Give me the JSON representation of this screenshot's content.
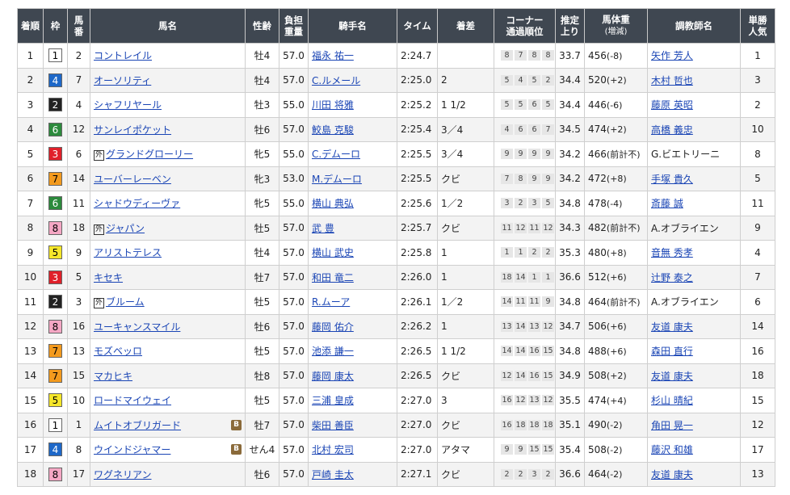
{
  "headers": {
    "rank": "着順",
    "waku": "枠",
    "num": [
      "馬",
      "番"
    ],
    "horse": "馬名",
    "sexage": "性齢",
    "weight": [
      "負担",
      "重量"
    ],
    "jockey": "騎手名",
    "time": "タイム",
    "margin": "着差",
    "corner": [
      "コーナー",
      "通過順位"
    ],
    "last3f": [
      "推定",
      "上り"
    ],
    "bodyweight": [
      "馬体重",
      "(増減)"
    ],
    "trainer": "調教師名",
    "pop": [
      "単勝",
      "人気"
    ]
  },
  "waku_colors": {
    "1": {
      "bg": "#ffffff",
      "fg": "#000000"
    },
    "2": {
      "bg": "#222222",
      "fg": "#ffffff"
    },
    "3": {
      "bg": "#e0202a",
      "fg": "#ffffff"
    },
    "4": {
      "bg": "#1e68c8",
      "fg": "#ffffff"
    },
    "5": {
      "bg": "#f5e62a",
      "fg": "#000000"
    },
    "6": {
      "bg": "#2c8a3c",
      "fg": "#ffffff"
    },
    "7": {
      "bg": "#f39a1e",
      "fg": "#000000"
    },
    "8": {
      "bg": "#f5a7c4",
      "fg": "#000000"
    }
  },
  "rows": [
    {
      "rank": "1",
      "waku": "1",
      "num": "2",
      "horse": "コントレイル",
      "foreign": false,
      "blinker": false,
      "sexage": "牡4",
      "weight": "57.0",
      "jockey": "福永 祐一",
      "time": "2:24.7",
      "margin": "",
      "corner": [
        "8",
        "7",
        "8",
        "8"
      ],
      "last3f": "33.7",
      "bw": "456",
      "bwd": "(-8)",
      "trainer": "矢作 芳人",
      "trainer_link": true,
      "pop": "1"
    },
    {
      "rank": "2",
      "waku": "4",
      "num": "7",
      "horse": "オーソリティ",
      "foreign": false,
      "blinker": false,
      "sexage": "牡4",
      "weight": "57.0",
      "jockey": "C.ルメール",
      "time": "2:25.0",
      "margin": "2",
      "corner": [
        "5",
        "4",
        "5",
        "2"
      ],
      "last3f": "34.4",
      "bw": "520",
      "bwd": "(+2)",
      "trainer": "木村 哲也",
      "trainer_link": true,
      "pop": "3"
    },
    {
      "rank": "3",
      "waku": "2",
      "num": "4",
      "horse": "シャフリヤール",
      "foreign": false,
      "blinker": false,
      "sexage": "牡3",
      "weight": "55.0",
      "jockey": "川田 将雅",
      "time": "2:25.2",
      "margin": "1 1/2",
      "corner": [
        "5",
        "5",
        "6",
        "5"
      ],
      "last3f": "34.4",
      "bw": "446",
      "bwd": "(-6)",
      "trainer": "藤原 英昭",
      "trainer_link": true,
      "pop": "2"
    },
    {
      "rank": "4",
      "waku": "6",
      "num": "12",
      "horse": "サンレイポケット",
      "foreign": false,
      "blinker": false,
      "sexage": "牡6",
      "weight": "57.0",
      "jockey": "鮫島 克駿",
      "time": "2:25.4",
      "margin": "3／4",
      "corner": [
        "4",
        "6",
        "6",
        "7"
      ],
      "last3f": "34.5",
      "bw": "474",
      "bwd": "(+2)",
      "trainer": "高橋 義忠",
      "trainer_link": true,
      "pop": "10"
    },
    {
      "rank": "5",
      "waku": "3",
      "num": "6",
      "horse": "グランドグローリー",
      "foreign": true,
      "blinker": false,
      "sexage": "牝5",
      "weight": "55.0",
      "jockey": "C.デムーロ",
      "time": "2:25.5",
      "margin": "3／4",
      "corner": [
        "9",
        "9",
        "9",
        "9"
      ],
      "last3f": "34.2",
      "bw": "466",
      "bwd": "(前計不)",
      "trainer": "G.ビエトリーニ",
      "trainer_link": false,
      "pop": "8"
    },
    {
      "rank": "6",
      "waku": "7",
      "num": "14",
      "horse": "ユーバーレーベン",
      "foreign": false,
      "blinker": false,
      "sexage": "牝3",
      "weight": "53.0",
      "jockey": "M.デムーロ",
      "time": "2:25.5",
      "margin": "クビ",
      "corner": [
        "7",
        "8",
        "9",
        "9"
      ],
      "last3f": "34.2",
      "bw": "472",
      "bwd": "(+8)",
      "trainer": "手塚 貴久",
      "trainer_link": true,
      "pop": "5"
    },
    {
      "rank": "7",
      "waku": "6",
      "num": "11",
      "horse": "シャドウディーヴァ",
      "foreign": false,
      "blinker": false,
      "sexage": "牝5",
      "weight": "55.0",
      "jockey": "横山 典弘",
      "time": "2:25.6",
      "margin": "1／2",
      "corner": [
        "3",
        "2",
        "3",
        "5"
      ],
      "last3f": "34.8",
      "bw": "478",
      "bwd": "(-4)",
      "trainer": "斎藤 誠",
      "trainer_link": true,
      "pop": "11"
    },
    {
      "rank": "8",
      "waku": "8",
      "num": "18",
      "horse": "ジャパン",
      "foreign": true,
      "blinker": false,
      "sexage": "牡5",
      "weight": "57.0",
      "jockey": "武 豊",
      "time": "2:25.7",
      "margin": "クビ",
      "corner": [
        "11",
        "12",
        "11",
        "12"
      ],
      "last3f": "34.3",
      "bw": "482",
      "bwd": "(前計不)",
      "trainer": "A.オブライエン",
      "trainer_link": false,
      "pop": "9"
    },
    {
      "rank": "9",
      "waku": "5",
      "num": "9",
      "horse": "アリストテレス",
      "foreign": false,
      "blinker": false,
      "sexage": "牡4",
      "weight": "57.0",
      "jockey": "横山 武史",
      "time": "2:25.8",
      "margin": "1",
      "corner": [
        "1",
        "1",
        "2",
        "2"
      ],
      "last3f": "35.3",
      "bw": "480",
      "bwd": "(+8)",
      "trainer": "音無 秀孝",
      "trainer_link": true,
      "pop": "4"
    },
    {
      "rank": "10",
      "waku": "3",
      "num": "5",
      "horse": "キセキ",
      "foreign": false,
      "blinker": false,
      "sexage": "牡7",
      "weight": "57.0",
      "jockey": "和田 竜二",
      "time": "2:26.0",
      "margin": "1",
      "corner": [
        "18",
        "14",
        "1",
        "1"
      ],
      "last3f": "36.6",
      "bw": "512",
      "bwd": "(+6)",
      "trainer": "辻野 泰之",
      "trainer_link": true,
      "pop": "7"
    },
    {
      "rank": "11",
      "waku": "2",
      "num": "3",
      "horse": "ブルーム",
      "foreign": true,
      "blinker": false,
      "sexage": "牡5",
      "weight": "57.0",
      "jockey": "R.ムーア",
      "time": "2:26.1",
      "margin": "1／2",
      "corner": [
        "14",
        "11",
        "11",
        "9"
      ],
      "last3f": "34.8",
      "bw": "464",
      "bwd": "(前計不)",
      "trainer": "A.オブライエン",
      "trainer_link": false,
      "pop": "6"
    },
    {
      "rank": "12",
      "waku": "8",
      "num": "16",
      "horse": "ユーキャンスマイル",
      "foreign": false,
      "blinker": false,
      "sexage": "牡6",
      "weight": "57.0",
      "jockey": "藤岡 佑介",
      "time": "2:26.2",
      "margin": "1",
      "corner": [
        "13",
        "14",
        "13",
        "12"
      ],
      "last3f": "34.7",
      "bw": "506",
      "bwd": "(+6)",
      "trainer": "友道 康夫",
      "trainer_link": true,
      "pop": "14"
    },
    {
      "rank": "13",
      "waku": "7",
      "num": "13",
      "horse": "モズベッロ",
      "foreign": false,
      "blinker": false,
      "sexage": "牡5",
      "weight": "57.0",
      "jockey": "池添 謙一",
      "time": "2:26.5",
      "margin": "1 1/2",
      "corner": [
        "14",
        "14",
        "16",
        "15"
      ],
      "last3f": "34.8",
      "bw": "488",
      "bwd": "(+6)",
      "trainer": "森田 直行",
      "trainer_link": true,
      "pop": "16"
    },
    {
      "rank": "14",
      "waku": "7",
      "num": "15",
      "horse": "マカヒキ",
      "foreign": false,
      "blinker": false,
      "sexage": "牡8",
      "weight": "57.0",
      "jockey": "藤岡 康太",
      "time": "2:26.5",
      "margin": "クビ",
      "corner": [
        "12",
        "14",
        "16",
        "15"
      ],
      "last3f": "34.9",
      "bw": "508",
      "bwd": "(+2)",
      "trainer": "友道 康夫",
      "trainer_link": true,
      "pop": "18"
    },
    {
      "rank": "15",
      "waku": "5",
      "num": "10",
      "horse": "ロードマイウェイ",
      "foreign": false,
      "blinker": false,
      "sexage": "牡5",
      "weight": "57.0",
      "jockey": "三浦 皇成",
      "time": "2:27.0",
      "margin": "3",
      "corner": [
        "16",
        "12",
        "13",
        "12"
      ],
      "last3f": "35.5",
      "bw": "474",
      "bwd": "(+4)",
      "trainer": "杉山 晴紀",
      "trainer_link": true,
      "pop": "15"
    },
    {
      "rank": "16",
      "waku": "1",
      "num": "1",
      "horse": "ムイトオブリガード",
      "foreign": false,
      "blinker": true,
      "sexage": "牡7",
      "weight": "57.0",
      "jockey": "柴田 善臣",
      "time": "2:27.0",
      "margin": "クビ",
      "corner": [
        "16",
        "18",
        "18",
        "18"
      ],
      "last3f": "35.1",
      "bw": "490",
      "bwd": "(-2)",
      "trainer": "角田 晃一",
      "trainer_link": true,
      "pop": "12"
    },
    {
      "rank": "17",
      "waku": "4",
      "num": "8",
      "horse": "ウインドジャマー",
      "foreign": false,
      "blinker": true,
      "sexage": "せん4",
      "weight": "57.0",
      "jockey": "北村 宏司",
      "time": "2:27.0",
      "margin": "アタマ",
      "corner": [
        "9",
        "9",
        "15",
        "15"
      ],
      "last3f": "35.4",
      "bw": "508",
      "bwd": "(-2)",
      "trainer": "藤沢 和雄",
      "trainer_link": true,
      "pop": "17"
    },
    {
      "rank": "18",
      "waku": "8",
      "num": "17",
      "horse": "ワグネリアン",
      "foreign": false,
      "blinker": false,
      "sexage": "牡6",
      "weight": "57.0",
      "jockey": "戸崎 圭太",
      "time": "2:27.1",
      "margin": "クビ",
      "corner": [
        "2",
        "2",
        "3",
        "2"
      ],
      "last3f": "36.6",
      "bw": "464",
      "bwd": "(-2)",
      "trainer": "友道 康夫",
      "trainer_link": true,
      "pop": "13"
    }
  ],
  "labels": {
    "foreign": "外",
    "blinker": "B"
  }
}
